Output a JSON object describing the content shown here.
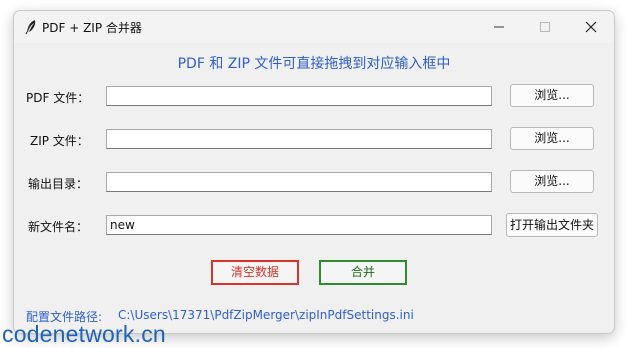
{
  "window": {
    "title": "PDF + ZIP 合并器"
  },
  "main": {
    "heading": "PDF 和 ZIP 文件可直接拖拽到对应输入框中",
    "pdf": {
      "label": "PDF 文件：",
      "value": "",
      "browse_label": "浏览..."
    },
    "zip": {
      "label": "ZIP 文件：",
      "value": "",
      "browse_label": "浏览..."
    },
    "output": {
      "label": "输出目录：",
      "value": "",
      "browse_label": "浏览..."
    },
    "filename": {
      "label": "新文件名：",
      "value": "new",
      "open_folder_label": "打开输出文件夹"
    },
    "clear_label": "清空数据",
    "merge_label": "合并",
    "config_label": "配置文件路径:",
    "config_path": "C:\\Users\\17371\\PdfZipMerger\\zipInPdfSettings.ini"
  },
  "watermark": "codenetwork.cn",
  "colors": {
    "accent": "#2f5fd0",
    "clear_border": "#d9342b",
    "merge_border": "#2e8b2e",
    "watermark": "#1e63b8"
  },
  "icons": {
    "app": "feather-icon",
    "minimize": "minimize-icon",
    "maximize": "maximize-icon",
    "close": "close-icon"
  }
}
